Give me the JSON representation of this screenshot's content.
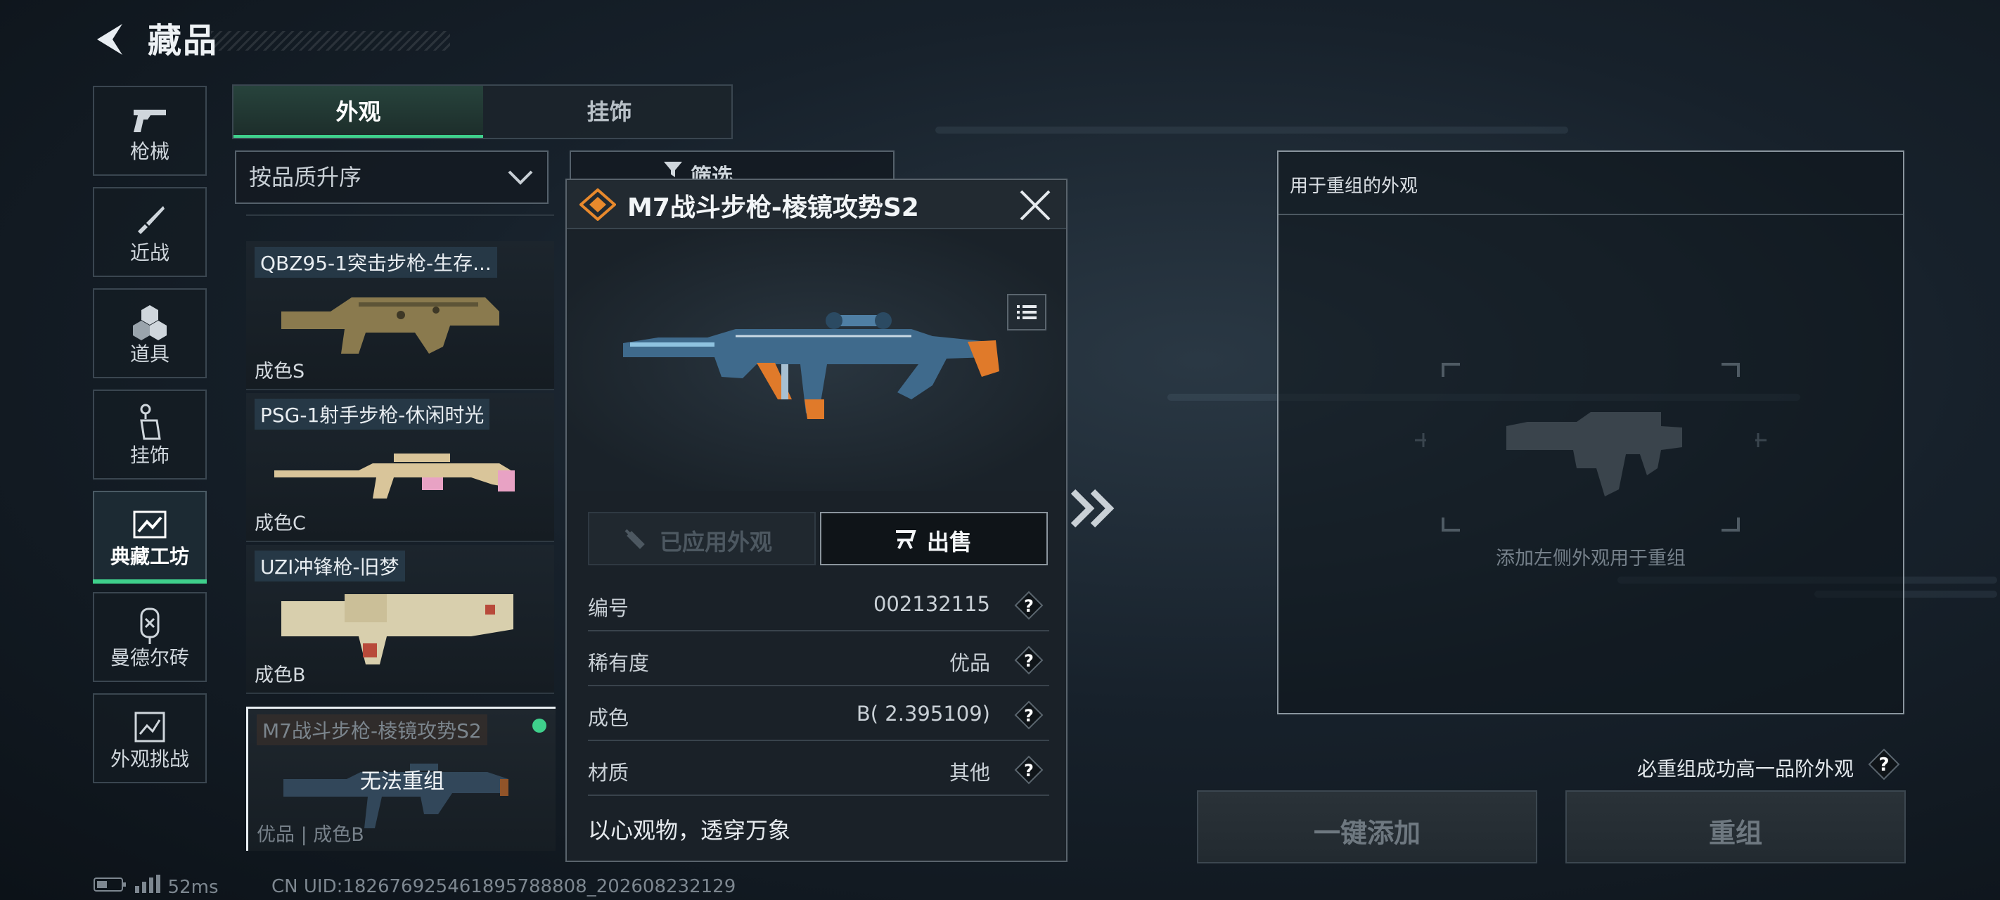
{
  "header": {
    "back_icon": "back-arrow-icon",
    "title": "藏品"
  },
  "sidebar": {
    "items": [
      {
        "label": "枪械",
        "icon": "gun-icon"
      },
      {
        "label": "近战",
        "icon": "knife-icon"
      },
      {
        "label": "道具",
        "icon": "grenade-icon"
      },
      {
        "label": "挂饰",
        "icon": "charm-icon"
      },
      {
        "label": "典藏工坊",
        "icon": "workshop-icon",
        "active": true
      },
      {
        "label": "曼德尔砖",
        "icon": "brick-icon"
      },
      {
        "label": "外观挑战",
        "icon": "challenge-icon"
      }
    ]
  },
  "tabs": [
    {
      "label": "外观",
      "active": true
    },
    {
      "label": "挂饰"
    }
  ],
  "sort": {
    "value": "按品质升序"
  },
  "filter": {
    "label": "筛选"
  },
  "items": [
    {
      "name": "QBZ95-1突击步枪-生存...",
      "condition": "成色S"
    },
    {
      "name": "PSG-1射手步枪-休闲时光",
      "condition": "成色C"
    },
    {
      "name": "UZI冲锋枪-旧梦",
      "condition": "成色B"
    },
    {
      "name": "M7战斗步枪-棱镜攻势S2",
      "condition": "优品 | 成色B",
      "overlay": "无法重组",
      "selected": true
    }
  ],
  "popup": {
    "title": "M7战斗步枪-棱镜攻势S2",
    "applied_label": "已应用外观",
    "sell_label": "出售",
    "rows": [
      {
        "key": "编号",
        "value": "002132115"
      },
      {
        "key": "稀有度",
        "value": "优品"
      },
      {
        "key": "成色",
        "value": "B( 2.395109)"
      },
      {
        "key": "材质",
        "value": "其他"
      }
    ],
    "motto": "以心观物，透穿万象"
  },
  "recompose": {
    "panel_title": "用于重组的外观",
    "hint": "添加左侧外观用于重组",
    "guarantee": "必重组成功高一品阶外观",
    "add_all_label": "一键添加",
    "recompose_label": "重组"
  },
  "status": {
    "ping": "52ms",
    "uid": "CN UID:182676925461895788808_202608232129"
  },
  "colors": {
    "accent": "#3fd08c",
    "rarity_orange": "#e8892c",
    "background": "#17212b"
  }
}
